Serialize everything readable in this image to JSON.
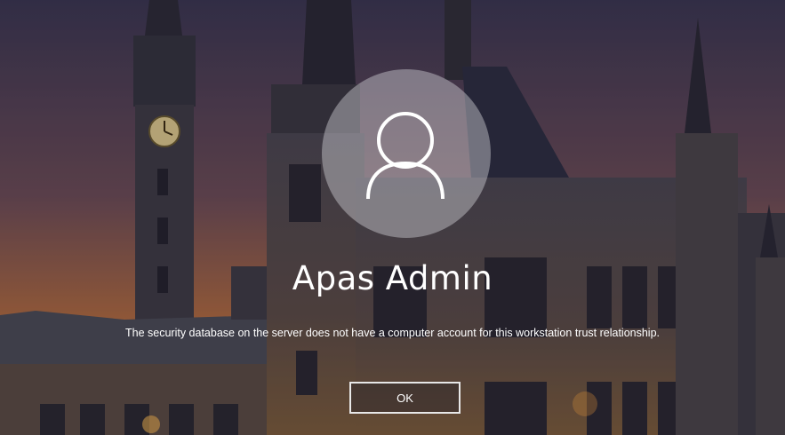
{
  "login": {
    "username": "Apas Admin",
    "message": "The security database on the server does not have a computer account for this workstation trust relationship.",
    "ok_label": "OK"
  },
  "icons": {
    "avatar": "user-icon"
  },
  "colors": {
    "sky_top": "#3a3550",
    "sky_bottom": "#c77a3a",
    "text": "#ffffff"
  }
}
